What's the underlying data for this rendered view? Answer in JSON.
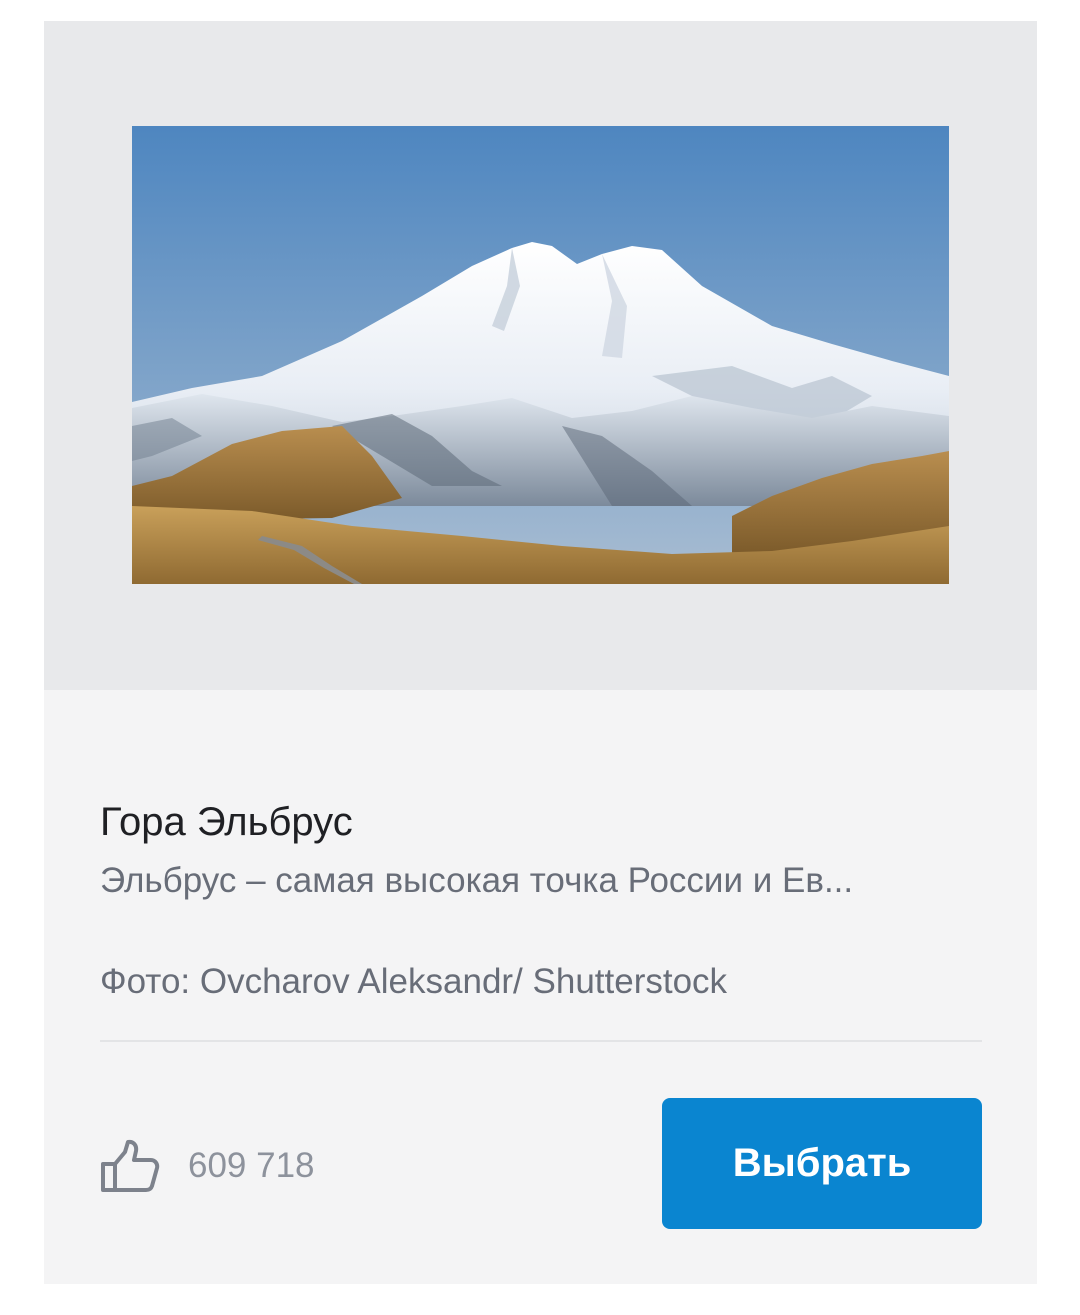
{
  "card": {
    "title": "Гора Эльбрус",
    "description": "Эльбрус – самая высокая точка России и Ев...",
    "credit": "Фото: Ovcharov Aleksandr/ Shutterstock",
    "likes": {
      "icon": "thumbs-up-icon",
      "count": "609 718"
    },
    "choose_label": "Выбрать"
  },
  "colors": {
    "accent": "#0a85d0",
    "card_bg": "#f4f4f5",
    "media_bg": "#e8e9eb",
    "title": "#1f2024",
    "secondary_text": "#686d78",
    "muted_text": "#8d929c"
  }
}
